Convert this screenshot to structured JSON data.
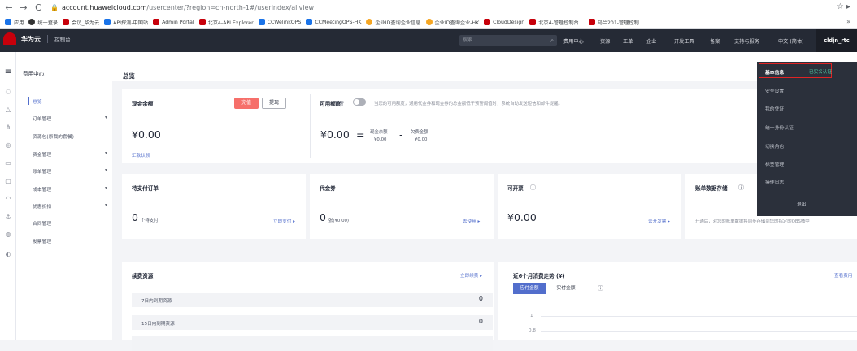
{
  "browser": {
    "url_host": "account.huaweicloud.com",
    "url_path": "/usercenter/?region=cn-north-1#/userindex/allview",
    "bookmarks": [
      "应用",
      "统一登录",
      "会议_华为云",
      "API探测-中国站",
      "Admin Portal",
      "北京4-API Explorer",
      "CCWelinkOPS",
      "CCMeetingOPS-HK",
      "企业ID查询企业信息",
      "企业ID查询企业-HK",
      "CloudDesign",
      "北京4-管理控制台...",
      "乌兰201-管理控制..."
    ],
    "more": "»"
  },
  "topbar": {
    "brand": "华为云",
    "console": "控制台",
    "search_placeholder": "搜索",
    "nav": [
      "费用中心",
      "资源",
      "工单",
      "企业",
      "开发工具",
      "备案",
      "支持与服务",
      "中文 (简体)"
    ],
    "user": "cldjn_rtc"
  },
  "sidebar": {
    "title": "费用中心",
    "items": [
      {
        "label": "总览",
        "caret": ""
      },
      {
        "label": "订单管理",
        "caret": "▾"
      },
      {
        "label": "资源包(原我的套餐)",
        "caret": ""
      },
      {
        "label": "资金管理",
        "caret": "▾"
      },
      {
        "label": "账单管理",
        "caret": "▾"
      },
      {
        "label": "成本管理",
        "caret": "▾"
      },
      {
        "label": "优惠折扣",
        "caret": "▾"
      },
      {
        "label": "合同管理",
        "caret": ""
      },
      {
        "label": "发票管理",
        "caret": ""
      }
    ]
  },
  "main": {
    "title": "总览",
    "cash": {
      "title": "现金余额",
      "recharge": "充值",
      "withdraw": "提现",
      "amount": "¥0.00",
      "link": "汇款认领"
    },
    "credit": {
      "title": "可用额度",
      "warn": "预警",
      "note": "当您的可用额度，通用代金券和现金券的总金额低于预警阈值时，系统自动发送短信和邮件提醒。",
      "amount": "¥0.00",
      "eq": "=",
      "cash_label": "现金余额",
      "cash_val": "¥0.00",
      "minus": "-",
      "owed_label": "欠费金额",
      "owed_val": "¥0.00"
    },
    "pending": {
      "title": "待支付订单",
      "count": "0",
      "unit": "个待支付",
      "link": "立即支付 ▸"
    },
    "coupon": {
      "title": "代金券",
      "count": "0",
      "unit": "张(¥0.00)",
      "link": "去使用 ▸"
    },
    "invoice": {
      "title": "可开票",
      "amount": "¥0.00",
      "link": "去开发票 ▸"
    },
    "storage": {
      "title": "账单数据存储",
      "note": "开通后，对您的账单数据将同步存储到您的指定的OBS桶中"
    },
    "renew": {
      "title": "续费资源",
      "link": "立即续费 ▸",
      "rows": [
        {
          "label": "7日内到期资源",
          "value": "0"
        },
        {
          "label": "15日内到期资源",
          "value": "0"
        }
      ]
    },
    "trend": {
      "title": "近6个月消费走势 (¥)",
      "link": "查看费用",
      "tabs": [
        "应付金额",
        "实付金额"
      ],
      "y_ticks": [
        "1",
        "0.8"
      ]
    }
  },
  "dropdown": {
    "items": [
      "基本信息",
      "安全设置",
      "我的凭证",
      "统一身份认证",
      "切换角色",
      "标签管理",
      "操作日志",
      "退出"
    ],
    "verified": "已实名认证"
  }
}
